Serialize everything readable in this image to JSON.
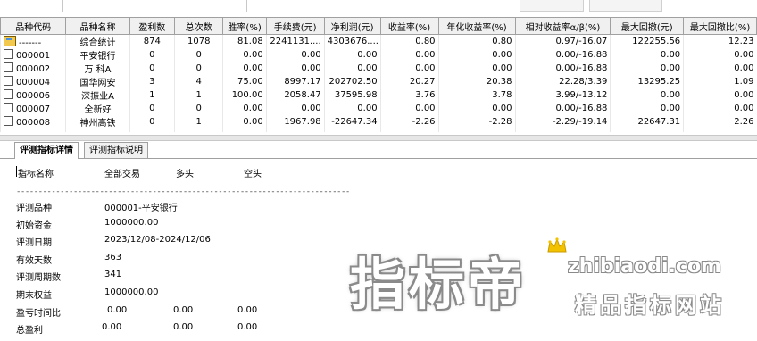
{
  "grid": {
    "columns": [
      "品种代码",
      "品种名称",
      "盈利数",
      "总次数",
      "胜率(%)",
      "手续费(元)",
      "净利润(元)",
      "收益率(%)",
      "年化收益率(%)",
      "相对收益率α/β(%)",
      "最大回撤(元)",
      "最大回撤比(%)"
    ],
    "rows": [
      [
        "-------",
        "综合统计",
        "874",
        "1078",
        "81.08",
        "2241131....",
        "4303676....",
        "0.80",
        "0.80",
        "0.97/-16.07",
        "122255.56",
        "12.23"
      ],
      [
        "000001",
        "平安银行",
        "0",
        "0",
        "0.00",
        "0.00",
        "0.00",
        "0.00",
        "0.00",
        "0.00/-16.88",
        "0.00",
        "0.00"
      ],
      [
        "000002",
        "万 科A",
        "0",
        "0",
        "0.00",
        "0.00",
        "0.00",
        "0.00",
        "0.00",
        "0.00/-16.88",
        "0.00",
        "0.00"
      ],
      [
        "000004",
        "国华网安",
        "3",
        "4",
        "75.00",
        "8997.17",
        "202702.50",
        "20.27",
        "20.38",
        "22.28/3.39",
        "13295.25",
        "1.09"
      ],
      [
        "000006",
        "深振业A",
        "1",
        "1",
        "100.00",
        "2058.47",
        "37595.98",
        "3.76",
        "3.78",
        "3.99/-13.12",
        "0.00",
        "0.00"
      ],
      [
        "000007",
        "全新好",
        "0",
        "0",
        "0.00",
        "0.00",
        "0.00",
        "0.00",
        "0.00",
        "0.00/-16.88",
        "0.00",
        "0.00"
      ],
      [
        "000008",
        "神州高铁",
        "0",
        "1",
        "0.00",
        "1967.98",
        "-22647.34",
        "-2.26",
        "-2.28",
        "-2.29/-19.14",
        "22647.31",
        "2.26"
      ]
    ]
  },
  "tabs": {
    "detail": "评测指标详情",
    "explain": "评测指标说明"
  },
  "detail": {
    "header": {
      "name": "指标名称",
      "all": "全部交易",
      "long": "多头",
      "short": "空头"
    },
    "dashes": "----------------------------------------------------------------------------",
    "items": [
      {
        "label": "评测品种",
        "v1": "000001-平安银行",
        "v2": "",
        "v3": ""
      },
      {
        "label": "初始资金",
        "v1": "1000000.00",
        "v2": "",
        "v3": ""
      },
      {
        "label": "评测日期",
        "v1": "2023/12/08-2024/12/06",
        "v2": "",
        "v3": ""
      },
      {
        "label": "有效天数",
        "v1": "363",
        "v2": "",
        "v3": ""
      },
      {
        "label": "评测周期数",
        "v1": "341",
        "v2": "",
        "v3": ""
      },
      {
        "label": "期末权益",
        "v1": "1000000.00",
        "v2": "",
        "v3": ""
      },
      {
        "label": "盈亏时间比",
        "v1": "0.00",
        "v2": "0.00",
        "v3": "0.00"
      },
      {
        "label": "总盈利",
        "v1": "0.00",
        "v2": "0.00",
        "v3": "0.00"
      }
    ]
  },
  "watermark": {
    "main": "指标帝",
    "url": "zhibiaodi.com",
    "sub": "精品指标网站"
  }
}
